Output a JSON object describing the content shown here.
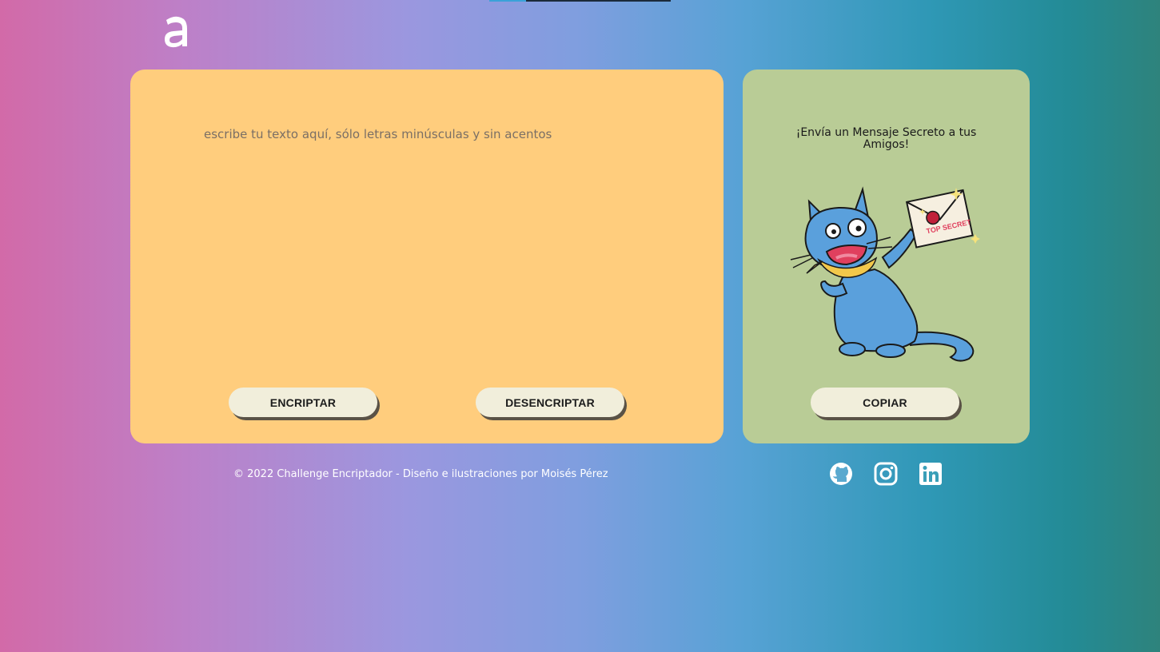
{
  "header": {
    "logo_icon": "alura-a-logo-icon"
  },
  "input_panel": {
    "placeholder": "escribe tu texto aquí, sólo letras minúsculas y sin acentos",
    "value": "",
    "encrypt_label": "ENCRIPTAR",
    "decrypt_label": "DESENCRIPTAR",
    "background_color": "#ffcd7d"
  },
  "output_panel": {
    "title": "¡Envía un Mensaje Secreto a tus Amigos!",
    "illustration_icon": "cat-holding-secret-letter-icon",
    "stamp_text": "TOP SECRET",
    "copy_label": "COPIAR",
    "background_color": "#b9cc96"
  },
  "footer": {
    "copyright": "© 2022 Challenge Encriptador - Diseño e ilustraciones por Moisés Pérez",
    "social_icons": [
      "github-icon",
      "instagram-icon",
      "linkedin-icon"
    ]
  },
  "colors": {
    "button_bg": "#f1eedb",
    "button_shadow": "#5a5246"
  }
}
